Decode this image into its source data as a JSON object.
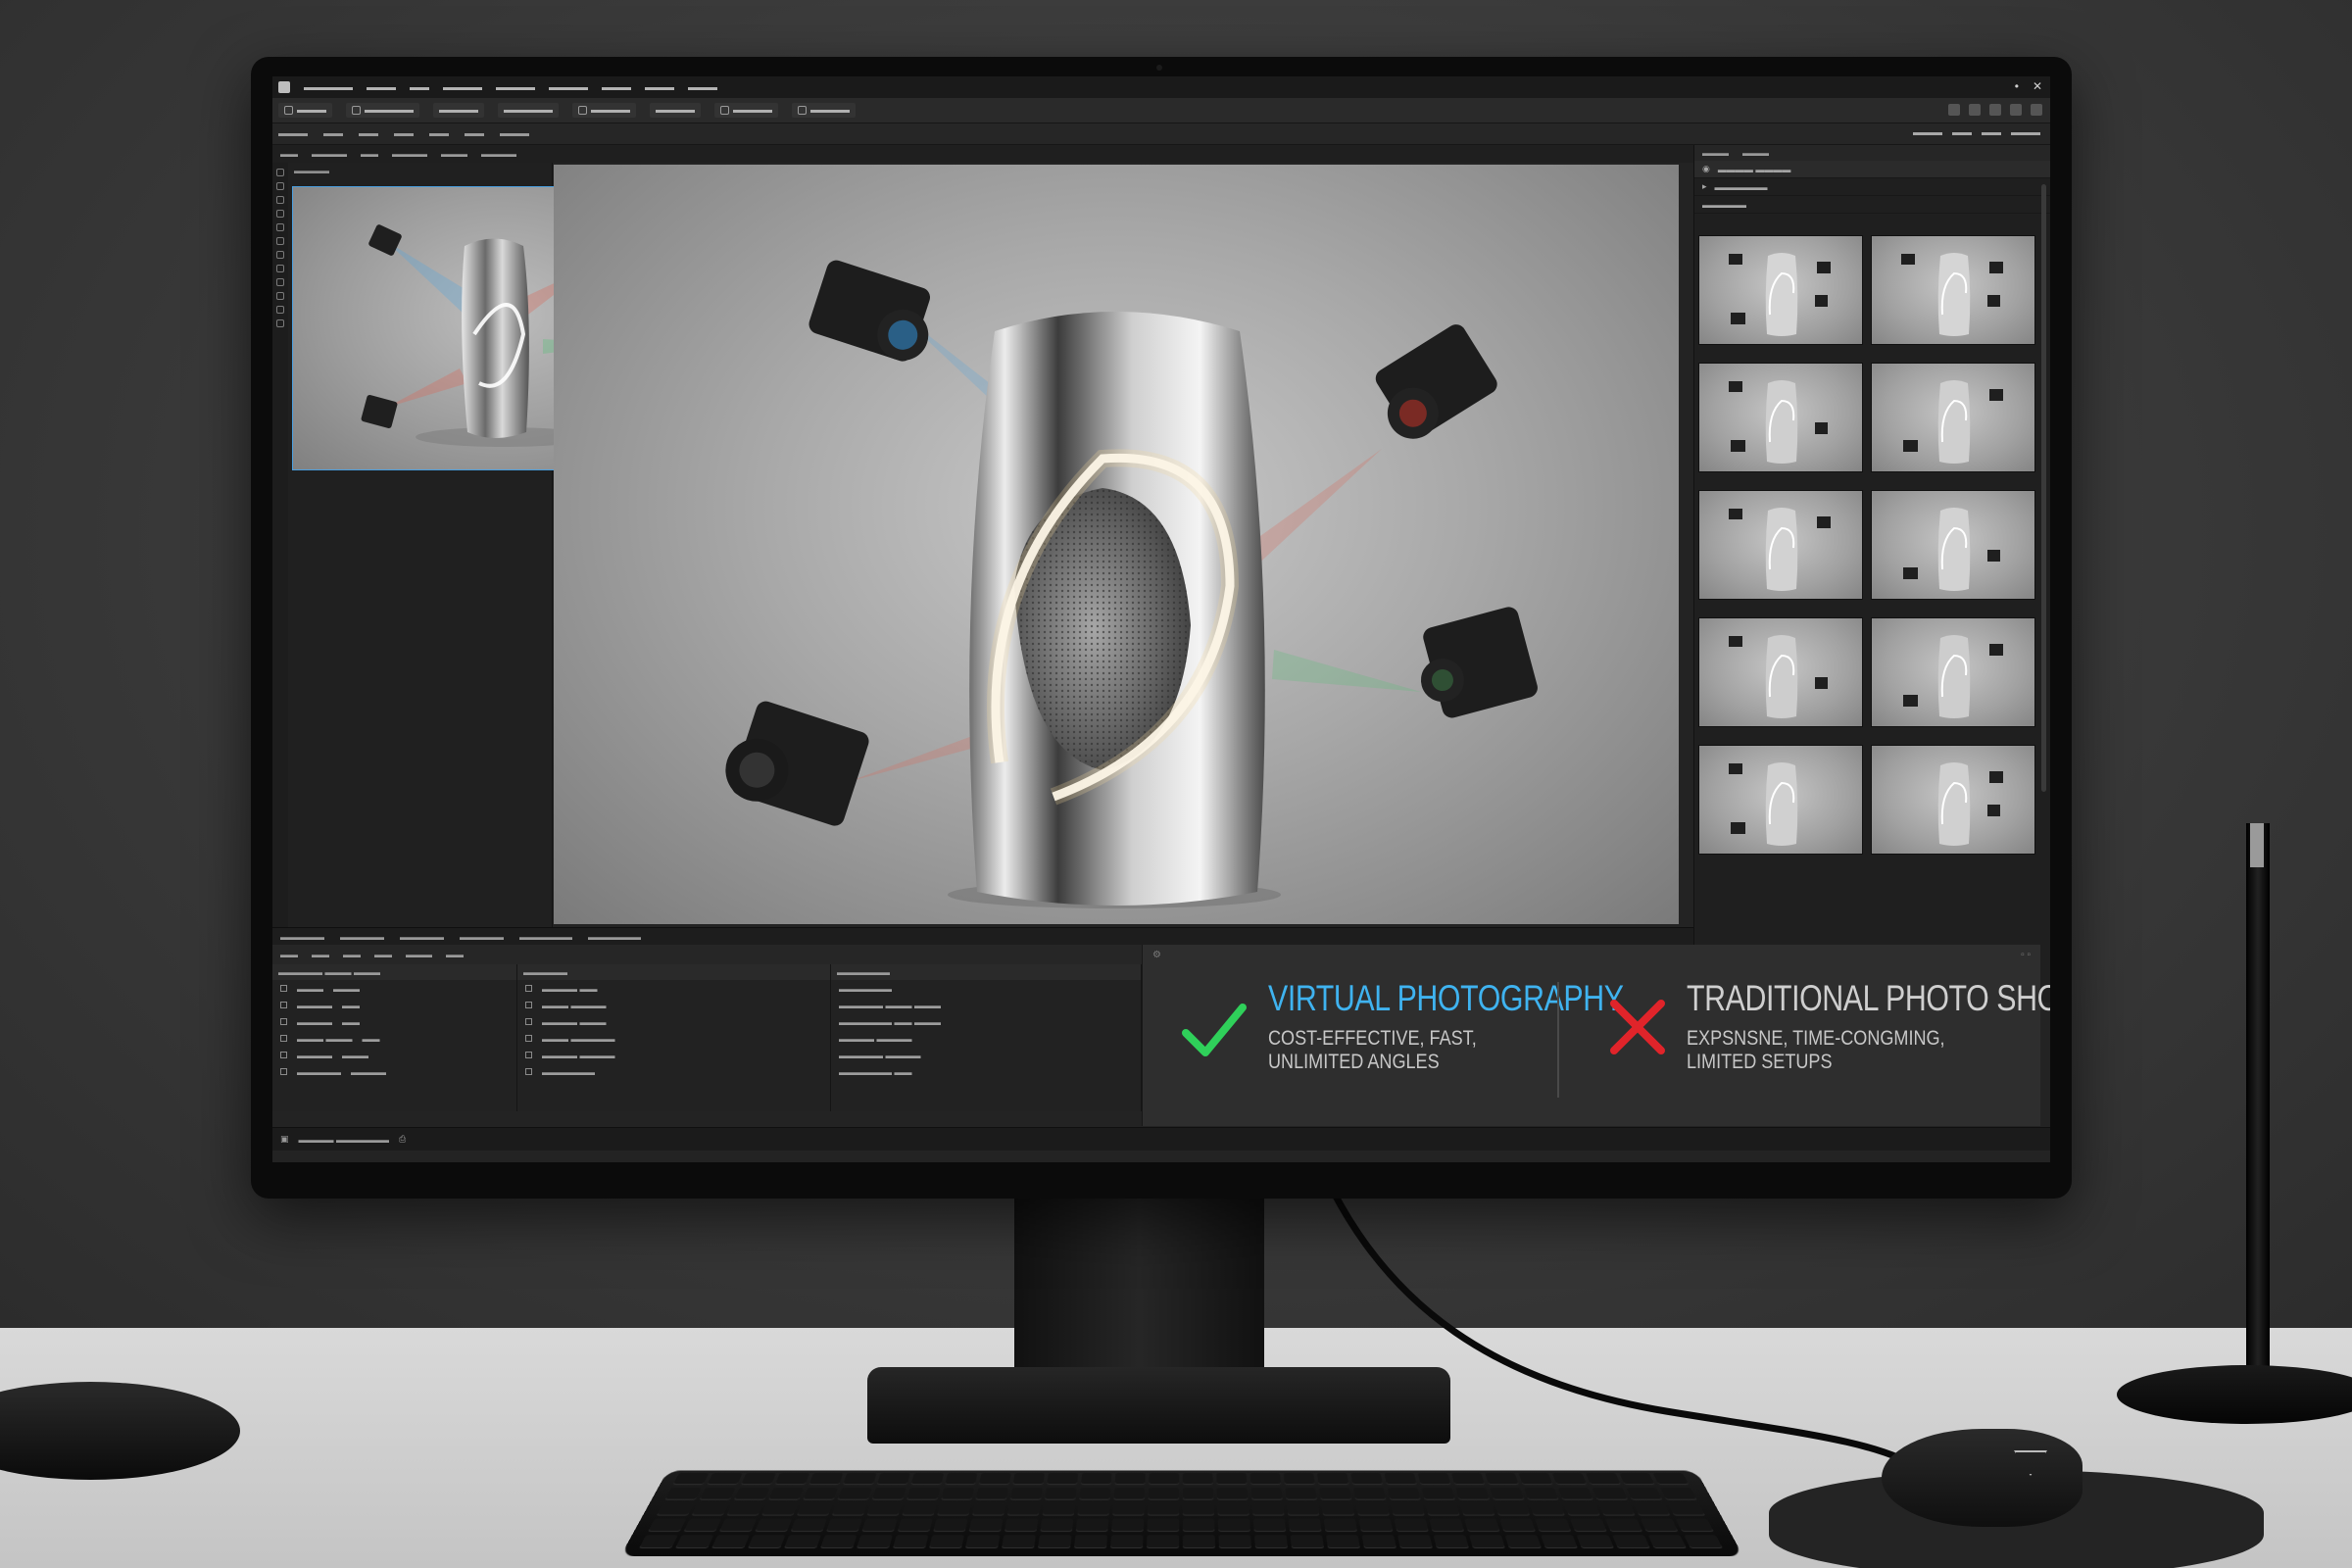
{
  "comparison": {
    "virtual": {
      "title": "VIRTUAL PHOTOGRAPHY",
      "subtitle_line1": "COST-EFFECTIVE, FAST,",
      "subtitle_line2": "UNLIMITED ANGLES",
      "color": "#3fb3f0",
      "icon": "check-icon",
      "icon_color": "#2fd05a"
    },
    "traditional": {
      "title": "TRADITIONAL PHOTO SHOOT",
      "subtitle_line1": "EXPSNSNE, TIME-CONGMING,",
      "subtitle_line2": "LIMITED SETUPS",
      "color": "#cfcfcf",
      "icon": "cross-icon",
      "icon_color": "#e0242a"
    }
  },
  "colors": {
    "accent": "#4a9fe0",
    "camera_beam_blue": "#5fa6d8",
    "camera_beam_red": "#d86a5c",
    "camera_beam_green": "#5cc07a"
  }
}
